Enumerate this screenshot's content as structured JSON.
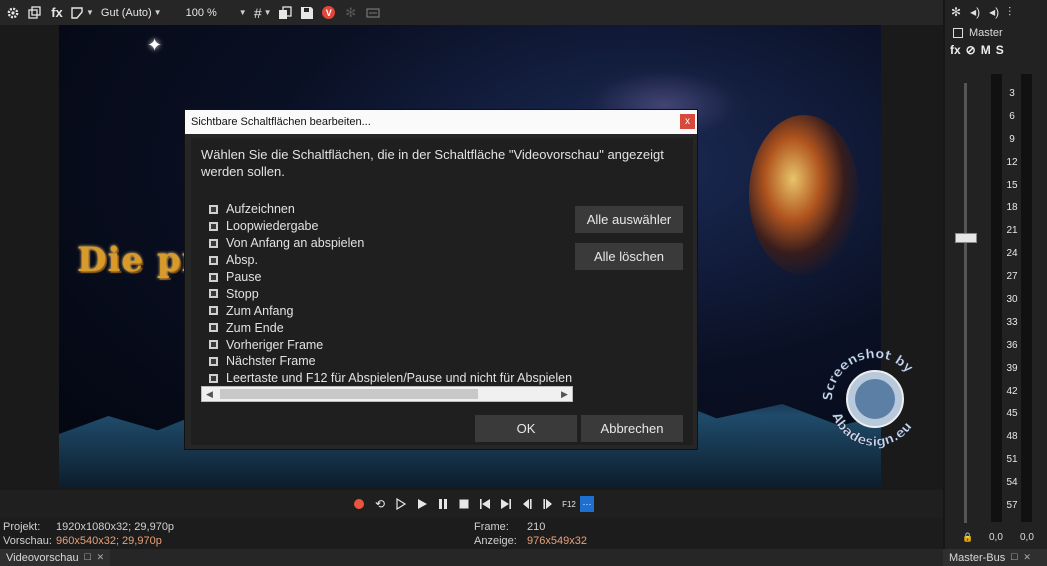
{
  "toolbar": {
    "quality": "Gut (Auto)",
    "zoom": "100 %",
    "icons": [
      "gear-icon",
      "windows-icon",
      "fx-icon",
      "split-icon",
      "grid-icon",
      "copy-icon",
      "save-icon",
      "v-icon",
      "settings-disabled-icon",
      "overlay-icon"
    ]
  },
  "dialog": {
    "title": "Sichtbare Schaltflächen bearbeiten...",
    "close_label": "x",
    "instruction": "Wählen Sie die Schaltflächen, die in der Schaltfläche \"Videovorschau\" angezeigt werden sollen.",
    "items": [
      "Aufzeichnen",
      "Loopwiedergabe",
      "Von Anfang an abspielen",
      "Absp.",
      "Pause",
      "Stopp",
      "Zum Anfang",
      "Zum Ende",
      "Vorheriger Frame",
      "Nächster Frame",
      "Leertaste und F12 für Abspielen/Pause und nicht für Abspielen"
    ],
    "select_all": "Alle auswähler",
    "clear_all": "Alle löschen",
    "ok": "OK",
    "cancel": "Abbrechen"
  },
  "video": {
    "title_text": "Die pr"
  },
  "watermark": {
    "top_text": "Screenshot by",
    "bottom_text": "Abadesign.eu"
  },
  "status": {
    "projekt_label": "Projekt:",
    "projekt_value": "1920x1080x32; 29,970p",
    "vorschau_label": "Vorschau:",
    "vorschau_value": "960x540x32; 29,970p",
    "frame_label": "Frame:",
    "frame_value": "210",
    "anzeige_label": "Anzeige:",
    "anzeige_value": "976x549x32"
  },
  "tabs": {
    "left": "Videovorschau",
    "right": "Master-Bus"
  },
  "mixer": {
    "master_label": "Master",
    "fx": "fx",
    "m": "M",
    "s": "S",
    "scale": [
      "3",
      "6",
      "9",
      "12",
      "15",
      "18",
      "21",
      "24",
      "27",
      "30",
      "33",
      "36",
      "39",
      "42",
      "45",
      "48",
      "51",
      "54",
      "57"
    ],
    "peak_left": "0,0",
    "peak_right": "0,0"
  },
  "colors": {
    "accent": "#1d6fd0",
    "record": "#e8563d",
    "status_accent": "#e9a27a",
    "close": "#d6493b"
  }
}
